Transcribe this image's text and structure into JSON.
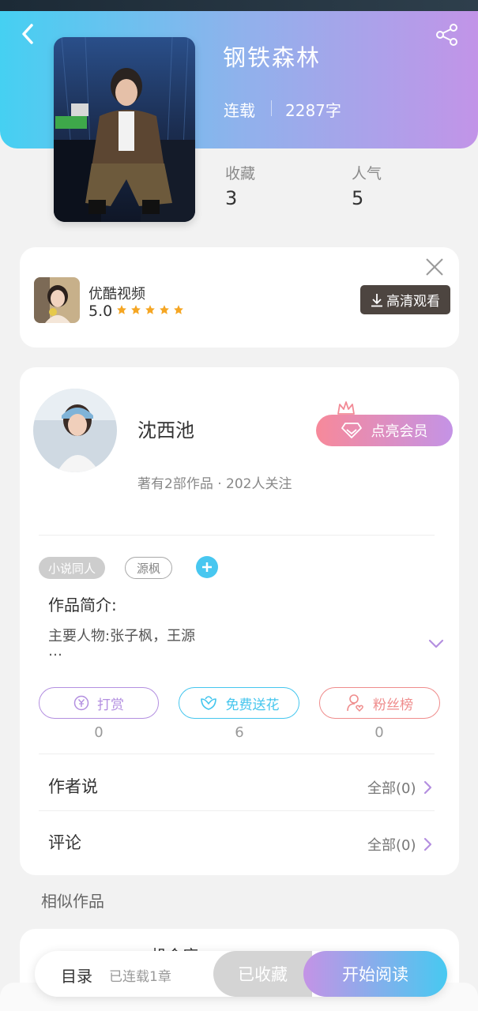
{
  "book": {
    "title": "钢铁森林",
    "status": "连载",
    "words": "2287字",
    "stats": [
      {
        "label": "收藏",
        "value": "3"
      },
      {
        "label": "人气",
        "value": "5"
      }
    ]
  },
  "ad": {
    "name": "优酷视频",
    "rating": "5.0",
    "stars": 5,
    "button_label": "高清观看"
  },
  "author": {
    "name": "沈西池",
    "info": "著有2部作品 · 202人关注",
    "vip_button": "点亮会员"
  },
  "tags": [
    "小说同人",
    "源枫"
  ],
  "intro": {
    "title": "作品简介:",
    "text": "主要人物:张子枫，王源",
    "more": "…"
  },
  "actions": [
    {
      "label": "打赏",
      "count": "0",
      "color": "#b38fe0"
    },
    {
      "label": "免费送花",
      "count": "6",
      "color": "#45c6ee"
    },
    {
      "label": "粉丝榜",
      "count": "0",
      "color": "#ef8c8c"
    }
  ],
  "rows": [
    {
      "title": "作者说",
      "right": "全部(0)"
    },
    {
      "title": "评论",
      "right": "全部(0)"
    }
  ],
  "similar": {
    "title": "相似作品",
    "first_item": "机会座"
  },
  "bottom": {
    "toc": "目录",
    "toc_sub": "已连载1章",
    "collected": "已收藏",
    "read": "开始阅读"
  },
  "colors": {
    "accent_purple": "#c493e6",
    "accent_blue": "#47c9f1",
    "star": "#f5a623"
  }
}
